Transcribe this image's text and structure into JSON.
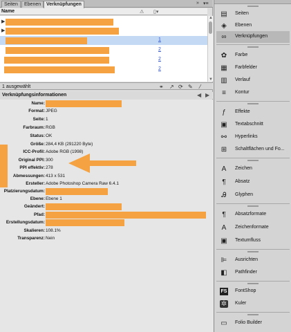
{
  "tabs": [
    "Seiten",
    "Ebenen",
    "Verknüpfungen"
  ],
  "list_header": {
    "name": "Name"
  },
  "list_rows": [
    {
      "page": ""
    },
    {
      "page": ""
    },
    {
      "page": "1"
    },
    {
      "page": "2"
    },
    {
      "page": "2"
    },
    {
      "page": "2"
    }
  ],
  "status_text": "1 ausgewählt",
  "info_title": "Verknüpfungsinformationen",
  "info_rows": [
    {
      "label": "Name:",
      "value": ""
    },
    {
      "label": "Format:",
      "value": "JPEG"
    },
    {
      "label": "Seite:",
      "value": "1"
    },
    {
      "label": "Farbraum:",
      "value": "RGB"
    },
    {
      "label": "Status:",
      "value": "OK"
    },
    {
      "label": "Größe:",
      "value": "284,4 KB (291220 Byte)"
    },
    {
      "label": "ICC-Profil:",
      "value": "Adobe RGB (1998)"
    },
    {
      "label": "Original PPI:",
      "value": "300"
    },
    {
      "label": "PPI effektiv:",
      "value": "278"
    },
    {
      "label": "Abmessungen:",
      "value": "413 x 531"
    },
    {
      "label": "Ersteller:",
      "value": "Adobe Photoshop Camera Raw 6.4.1"
    },
    {
      "label": "Platzierungsdatum:",
      "value": ""
    },
    {
      "label": "Ebene:",
      "value": "Ebene 1"
    },
    {
      "label": "Geändert:",
      "value": ""
    },
    {
      "label": "Pfad:",
      "value": ""
    },
    {
      "label": "Erstellungsdatum:",
      "value": ""
    },
    {
      "label": "Skalieren:",
      "value": "108.1%"
    },
    {
      "label": "Transparenz:",
      "value": "Nein"
    }
  ],
  "panels": [
    {
      "label": "Seiten",
      "icon": "pages-icon"
    },
    {
      "label": "Ebenen",
      "icon": "layers-icon"
    },
    {
      "label": "Verknüpfungen",
      "icon": "links-icon"
    },
    {
      "label": "Farbe",
      "icon": "color-icon"
    },
    {
      "label": "Farbfelder",
      "icon": "swatches-icon"
    },
    {
      "label": "Verlauf",
      "icon": "gradient-icon"
    },
    {
      "label": "Kontur",
      "icon": "stroke-icon"
    },
    {
      "label": "Effekte",
      "icon": "effects-icon"
    },
    {
      "label": "Textabschnitt",
      "icon": "story-icon"
    },
    {
      "label": "Hyperlinks",
      "icon": "hyperlinks-icon"
    },
    {
      "label": "Schaltflächen und Fo...",
      "icon": "buttons-icon"
    },
    {
      "label": "Zeichen",
      "icon": "character-icon"
    },
    {
      "label": "Absatz",
      "icon": "paragraph-icon"
    },
    {
      "label": "Glyphen",
      "icon": "glyphs-icon"
    },
    {
      "label": "Absatzformate",
      "icon": "paragraph-styles-icon"
    },
    {
      "label": "Zeichenformate",
      "icon": "character-styles-icon"
    },
    {
      "label": "Textumfluss",
      "icon": "text-wrap-icon"
    },
    {
      "label": "Ausrichten",
      "icon": "align-icon"
    },
    {
      "label": "Pathfinder",
      "icon": "pathfinder-icon"
    },
    {
      "label": "FontShop",
      "icon": "fontshop-icon"
    },
    {
      "label": "Kuler",
      "icon": "kuler-icon"
    },
    {
      "label": "Folio Builder",
      "icon": "folio-builder-icon"
    }
  ],
  "colors": {
    "redaction": "#f5a242",
    "selection": "#c4d9f3",
    "panel_bg": "#d4d4d4"
  }
}
